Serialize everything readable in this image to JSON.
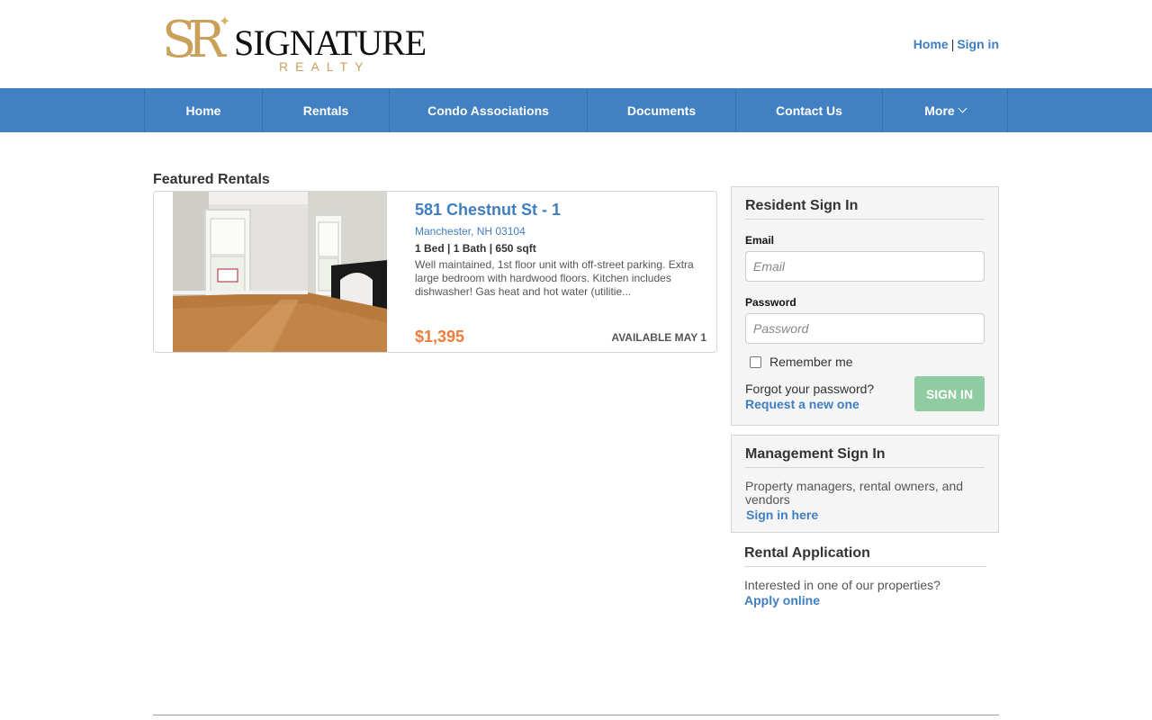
{
  "header": {
    "logo": {
      "monogram": "SR",
      "name": "SIGNATURE",
      "sub": "REALTY"
    },
    "links": [
      {
        "label": "Home"
      },
      {
        "label": "Sign in"
      }
    ],
    "separator": "|"
  },
  "nav": {
    "items": [
      {
        "label": "Home"
      },
      {
        "label": "Rentals"
      },
      {
        "label": "Condo Associations"
      },
      {
        "label": "Documents"
      },
      {
        "label": "Contact Us"
      },
      {
        "label": "More"
      }
    ]
  },
  "featured": {
    "title": "Featured Rentals",
    "listing": {
      "title": "581 Chestnut St - 1",
      "city": "Manchester, NH 03104",
      "specs": "1 Bed | 1 Bath | 650 sqft",
      "description": "Well maintained, 1st floor unit with off-street parking. Extra large bedroom with hardwood floors. Kitchen includes dishwasher! Gas heat and hot water (utilitie...",
      "price": "$1,395",
      "availability": "AVAILABLE MAY 1"
    }
  },
  "resident_signin": {
    "title": "Resident Sign In",
    "email_label": "Email",
    "email_placeholder": "Email",
    "password_label": "Password",
    "password_placeholder": "Password",
    "remember_label": "Remember me",
    "forgot_text": "Forgot your password?",
    "forgot_link": "Request a new one",
    "button": "SIGN IN"
  },
  "management_signin": {
    "title": "Management Sign In",
    "text": "Property managers, rental owners, and vendors",
    "link": "Sign in here"
  },
  "rental_application": {
    "title": "Rental Application",
    "text": "Interested in one of our properties?",
    "link": "Apply online"
  },
  "colors": {
    "nav": "#4080c3",
    "link": "#3f7ec0",
    "price": "#f07c3c",
    "signin_button": "#8fcca1",
    "logo_gold": "#c9a15a"
  }
}
